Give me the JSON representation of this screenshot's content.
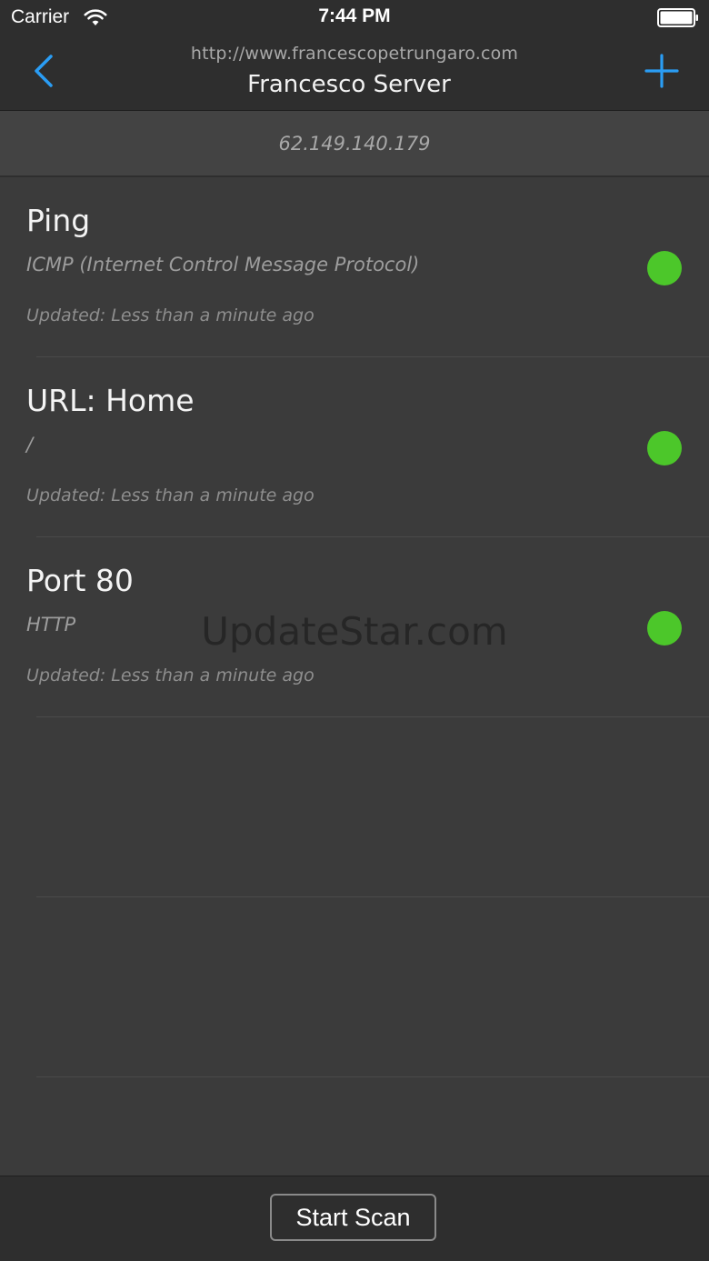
{
  "status_bar": {
    "carrier": "Carrier",
    "time": "7:44 PM"
  },
  "nav": {
    "url": "http://www.francescopetrungaro.com",
    "title": "Francesco Server",
    "back_icon": "chevron-left-icon",
    "add_icon": "plus-icon"
  },
  "header": {
    "ip": "62.149.140.179"
  },
  "items": [
    {
      "title": "Ping",
      "subtitle": "ICMP (Internet Control Message Protocol)",
      "updated": "Updated: Less than a minute ago",
      "status": "up",
      "status_color": "#4cc72a"
    },
    {
      "title": "URL: Home",
      "subtitle": "/",
      "updated": "Updated: Less than a minute ago",
      "status": "up",
      "status_color": "#4cc72a"
    },
    {
      "title": "Port 80",
      "subtitle": "HTTP",
      "updated": "Updated: Less than a minute ago",
      "status": "up",
      "status_color": "#4cc72a"
    }
  ],
  "watermark": "UpdateStar.com",
  "toolbar": {
    "start_scan_label": "Start Scan"
  },
  "colors": {
    "accent": "#2a9df4",
    "background": "#3b3b3b",
    "bar": "#2e2e2e"
  }
}
